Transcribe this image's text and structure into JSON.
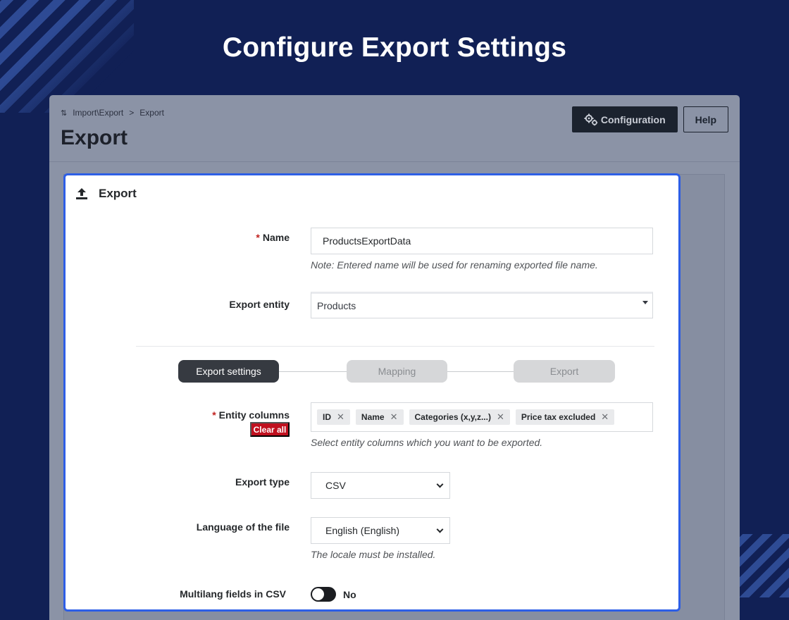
{
  "hero": {
    "title": "Configure Export Settings"
  },
  "header": {
    "breadcrumb": {
      "parent": "Import\\Export",
      "separator": ">",
      "current": "Export"
    },
    "title": "Export",
    "configuration_label": "Configuration",
    "help_label": "Help"
  },
  "panel": {
    "title": "Export",
    "name": {
      "required_mark": "*",
      "label": "Name",
      "value": "ProductsExportData",
      "note": "Note: Entered name will be used for renaming exported file name."
    },
    "entity": {
      "label": "Export entity",
      "value": "Products"
    },
    "steps": [
      {
        "label": "Export settings",
        "active": true
      },
      {
        "label": "Mapping",
        "active": false
      },
      {
        "label": "Export",
        "active": false
      }
    ],
    "columns": {
      "required_mark": "*",
      "label": "Entity columns",
      "clear_label": "Clear all",
      "tags": [
        "ID",
        "Name",
        "Categories (x,y,z...)",
        "Price tax excluded"
      ],
      "remove_glyph": "✕",
      "help": "Select entity columns which you want to be exported."
    },
    "export_type": {
      "label": "Export type",
      "value": "CSV"
    },
    "language": {
      "label": "Language of the file",
      "value": "English (English)",
      "help": "The locale must be installed."
    },
    "multilang": {
      "label": "Multilang fields in CSV",
      "value": "No",
      "on": false
    }
  },
  "colors": {
    "background": "#112055",
    "accent": "#2d5ee6",
    "danger": "#c0111f",
    "dark": "#363a41"
  }
}
